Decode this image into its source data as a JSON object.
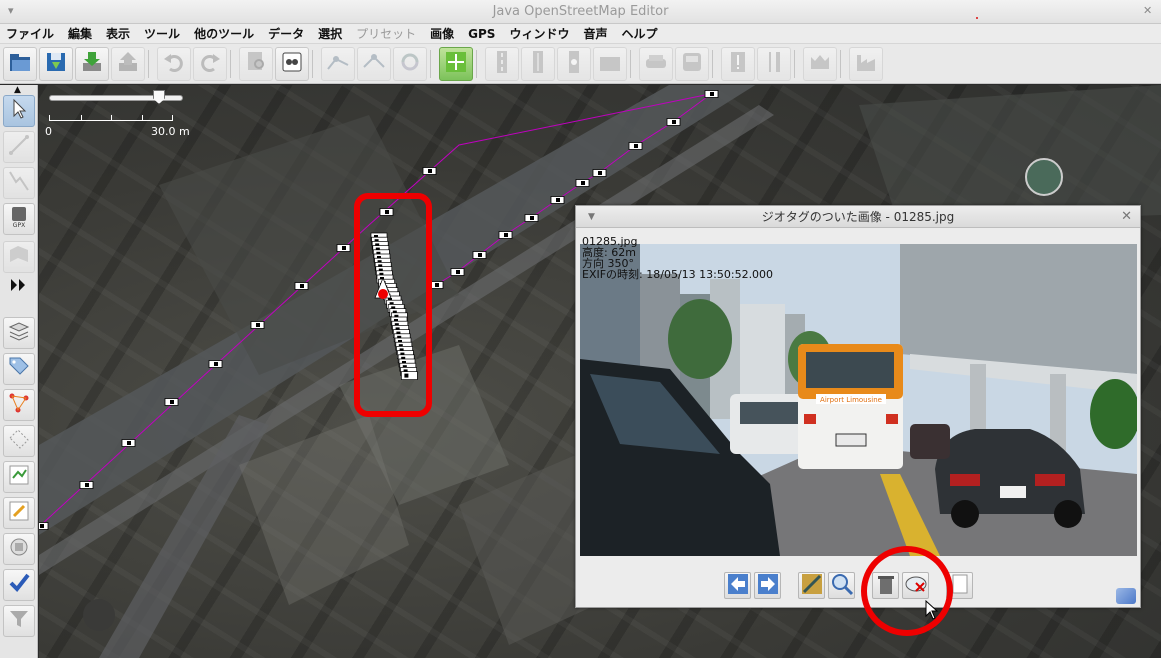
{
  "window": {
    "title": "Java OpenStreetMap Editor"
  },
  "menu": [
    {
      "label": "ファイル",
      "enabled": true
    },
    {
      "label": "編集",
      "enabled": true
    },
    {
      "label": "表示",
      "enabled": true
    },
    {
      "label": "ツール",
      "enabled": true
    },
    {
      "label": "他のツール",
      "enabled": true
    },
    {
      "label": "データ",
      "enabled": true
    },
    {
      "label": "選択",
      "enabled": true
    },
    {
      "label": "プリセット",
      "enabled": false
    },
    {
      "label": "画像",
      "enabled": true
    },
    {
      "label": "GPS",
      "enabled": true
    },
    {
      "label": "ウィンドウ",
      "enabled": true
    },
    {
      "label": "音声",
      "enabled": true
    },
    {
      "label": "ヘルプ",
      "enabled": true
    }
  ],
  "toolbar": {
    "buttons": [
      {
        "name": "open-file-icon",
        "enabled": true
      },
      {
        "name": "save-icon",
        "enabled": true
      },
      {
        "name": "download-icon",
        "enabled": true
      },
      {
        "name": "upload-icon",
        "enabled": false
      },
      {
        "name": "undo-icon",
        "enabled": false
      },
      {
        "name": "redo-icon",
        "enabled": false
      },
      {
        "name": "search-icon",
        "enabled": false
      },
      {
        "name": "preferences-icon",
        "enabled": true
      },
      {
        "name": "split-way-icon",
        "enabled": false
      },
      {
        "name": "combine-way-icon",
        "enabled": false
      },
      {
        "name": "reverse-way-icon",
        "enabled": false
      },
      {
        "name": "zoom-to-layer-icon",
        "enabled": true
      },
      {
        "name": "road-preset-icon",
        "enabled": false
      },
      {
        "name": "road-preset-2-icon",
        "enabled": false
      },
      {
        "name": "traffic-signal-icon",
        "enabled": false
      },
      {
        "name": "building-preset-icon",
        "enabled": false
      },
      {
        "name": "car-preset-icon",
        "enabled": false
      },
      {
        "name": "bus-preset-icon",
        "enabled": false
      },
      {
        "name": "hazard-preset-icon",
        "enabled": false
      },
      {
        "name": "restaurant-preset-icon",
        "enabled": false
      },
      {
        "name": "castle-preset-icon",
        "enabled": false
      },
      {
        "name": "factory-preset-icon",
        "enabled": false
      }
    ]
  },
  "leftbar": {
    "buttons": [
      {
        "name": "select-tool-icon",
        "selected": true
      },
      {
        "name": "draw-nodes-icon"
      },
      {
        "name": "draw-way-icon"
      },
      {
        "name": "gpx-layer-icon"
      },
      {
        "name": "building-tool-icon"
      },
      {
        "name": "expand-icon"
      },
      {
        "name": "layers-icon"
      },
      {
        "name": "tags-icon"
      },
      {
        "name": "relations-icon"
      },
      {
        "name": "selection-list-icon"
      },
      {
        "name": "history-icon"
      },
      {
        "name": "conflict-icon"
      },
      {
        "name": "imagery-icon"
      },
      {
        "name": "validator-icon"
      },
      {
        "name": "filter-icon"
      }
    ]
  },
  "map": {
    "scale": {
      "start": "0",
      "end": "30.0 m"
    },
    "gpx_track_color": "#c000c0"
  },
  "image_dialog": {
    "title": "ジオタグのついた画像 - 01285.jpg",
    "info": {
      "filename": "01285.jpg",
      "elevation": "高度: 62m",
      "direction": "方向 350°",
      "exif_time": "EXIFの時刻: 18/05/13 13:50:52.000"
    },
    "buttons": [
      {
        "name": "previous-image-icon"
      },
      {
        "name": "next-image-icon"
      },
      {
        "name": "center-view-icon"
      },
      {
        "name": "zoom-actual-size-icon"
      },
      {
        "name": "delete-image-icon"
      },
      {
        "name": "remove-from-layer-icon"
      },
      {
        "name": "copy-path-icon"
      }
    ]
  },
  "photo_scene": {
    "bus_label": "Airport Limousine"
  }
}
